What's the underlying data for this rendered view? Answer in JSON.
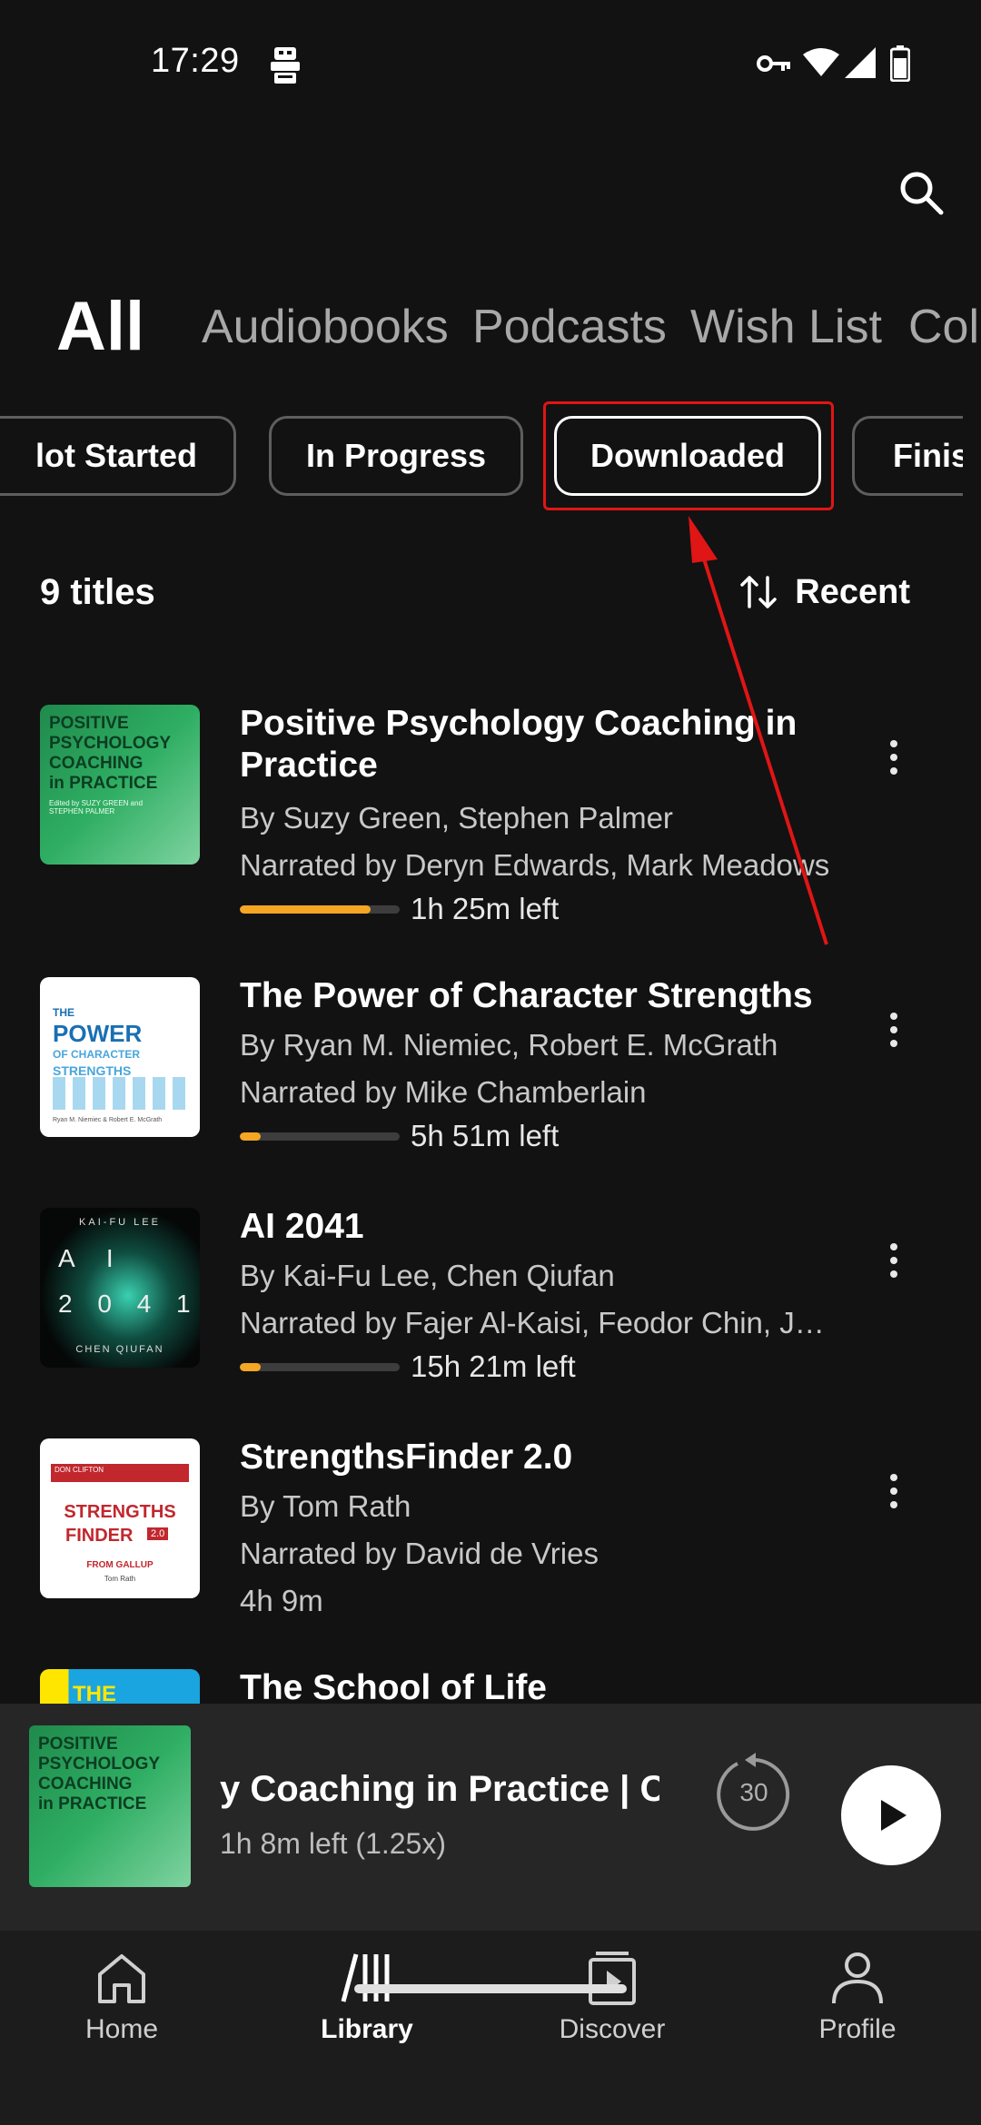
{
  "status_bar": {
    "time": "17:29"
  },
  "category_tabs": [
    {
      "label": "All",
      "active": true
    },
    {
      "label": "Audiobooks",
      "active": false
    },
    {
      "label": "Podcasts",
      "active": false
    },
    {
      "label": "Wish List",
      "active": false
    },
    {
      "label": "Coll",
      "active": false
    }
  ],
  "filter_chips": [
    {
      "label": "lot Started",
      "selected": false
    },
    {
      "label": "In Progress",
      "selected": false
    },
    {
      "label": "Downloaded",
      "selected": true
    },
    {
      "label": "Finis",
      "selected": false
    }
  ],
  "library": {
    "count_label": "9 titles",
    "sort_label": "Recent"
  },
  "books": [
    {
      "title": "Positive Psychology Coaching in Practice",
      "authors": "By Suzy Green, Stephen Palmer",
      "narrators": "Narrated by Deryn Edwards, Mark Meadows",
      "time_left": "1h 25m left",
      "progress": 0.82,
      "cover_lines": [
        "POSITIVE",
        "PSYCHOLOGY",
        "COACHING",
        "in PRACTICE"
      ],
      "cover_small": "Edited by SUZY GREEN and STEPHEN PALMER"
    },
    {
      "title": "The Power of Character Strengths",
      "authors": "By Ryan M. Niemiec, Robert E. McGrath",
      "narrators": "Narrated by Mike Chamberlain",
      "time_left": "5h 51m left",
      "progress": 0.13,
      "cover_lines": [
        "THE",
        "POWER",
        "OF CHARACTER",
        "STRENGTHS"
      ],
      "cover_small": "Ryan M. Niemiec & Robert E. McGrath"
    },
    {
      "title": "AI 2041",
      "authors": "By Kai-Fu Lee, Chen Qiufan",
      "narrators": "Narrated by Fajer Al-Kaisi, Feodor Chin, Jam…",
      "time_left": "15h 21m left",
      "progress": 0.13,
      "cover_lines": [
        "KAI-FU LEE",
        "A I",
        "2 0 4 1",
        "CHEN QIUFAN"
      ]
    },
    {
      "title": "StrengthsFinder 2.0",
      "authors": "By Tom Rath",
      "narrators": "Narrated by David de Vries",
      "time_left": "4h 9m",
      "cover_lines": [
        "DON CLIFTON",
        "STRENGTHS",
        "FINDER",
        "2.0",
        "FROM GALLUP",
        "Tom Rath"
      ]
    },
    {
      "title": "The School of Life",
      "cover_lines": [
        "THE"
      ]
    }
  ],
  "mini_player": {
    "title": "y Coaching in Practice | Cha",
    "subtitle": "1h 8m left (1.25x)",
    "skip_seconds": "30",
    "cover_lines": [
      "POSITIVE",
      "PSYCHOLOGY",
      "COACHING",
      "in PRACTICE"
    ]
  },
  "bottom_nav": [
    {
      "label": "Home",
      "icon": "home-icon",
      "active": false
    },
    {
      "label": "Library",
      "icon": "library-icon",
      "active": true
    },
    {
      "label": "Discover",
      "icon": "discover-icon",
      "active": false
    },
    {
      "label": "Profile",
      "icon": "profile-icon",
      "active": false
    }
  ],
  "colors": {
    "background": "#121212",
    "progress_fill": "#f5a623",
    "highlight_box": "#e01515",
    "arrow": "#e01515"
  }
}
